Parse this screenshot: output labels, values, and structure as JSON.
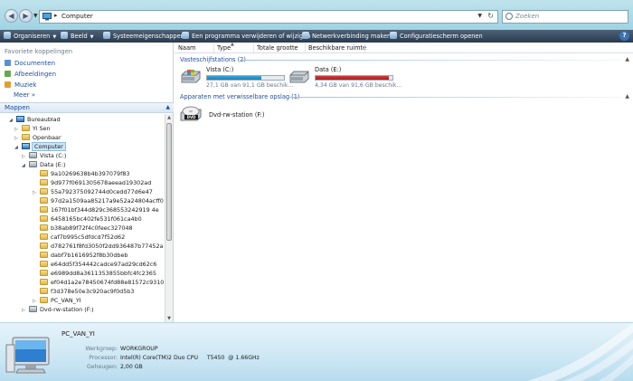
{
  "address": {
    "path": "Computer",
    "search_placeholder": "Zoeken"
  },
  "toolbar": {
    "items": [
      {
        "label": "Organiseren",
        "dropdown": true
      },
      {
        "label": "Beeld",
        "dropdown": true
      },
      {
        "label": "Systeemeigenschappen"
      },
      {
        "label": "Een programma verwijderen of wijzigen"
      },
      {
        "label": "Netwerkverbinding maken"
      },
      {
        "label": "Configuratiescherm openen"
      }
    ],
    "help": "?"
  },
  "left": {
    "favorites_title": "Favoriete koppelingen",
    "favorites": [
      {
        "label": "Documenten",
        "color": "#5b8fd0"
      },
      {
        "label": "Afbeeldingen",
        "color": "#6aa84f"
      },
      {
        "label": "Muziek",
        "color": "#e0a030"
      }
    ],
    "more_label": "Meer",
    "more_glyph": "»",
    "folders_label": "Mappen",
    "tree": [
      {
        "label": "Bureaublad",
        "indent": 0,
        "toggle": "◢",
        "icon": "desktop"
      },
      {
        "label": "Yi Sen",
        "indent": 1,
        "toggle": "▷",
        "icon": "folder"
      },
      {
        "label": "Openbaar",
        "indent": 1,
        "toggle": "▷",
        "icon": "folder"
      },
      {
        "label": "Computer",
        "indent": 1,
        "toggle": "◢",
        "icon": "computer",
        "selected": true
      },
      {
        "label": "Vista (C:)",
        "indent": 2,
        "toggle": "▷",
        "icon": "drive"
      },
      {
        "label": "Data (E:)",
        "indent": 2,
        "toggle": "◢",
        "icon": "drive"
      },
      {
        "label": "9a10269638b4b397079f83",
        "indent": 3,
        "toggle": "",
        "icon": "folder"
      },
      {
        "label": "9d977f0691305678aeead19302ad",
        "indent": 3,
        "toggle": "",
        "icon": "folder"
      },
      {
        "label": "55a792375092744d0cedd77d6e47",
        "indent": 3,
        "toggle": "▷",
        "icon": "folder"
      },
      {
        "label": "97d2a1509aa85217a9e52a24804acff0",
        "indent": 3,
        "toggle": "",
        "icon": "folder"
      },
      {
        "label": "167f01bf344d829c368553242919 4e",
        "indent": 3,
        "toggle": "",
        "icon": "folder"
      },
      {
        "label": "6458165bc402fe531f061ca4b0",
        "indent": 3,
        "toggle": "",
        "icon": "folder"
      },
      {
        "label": "b38ab89f72f4c0feec327048",
        "indent": 3,
        "toggle": "",
        "icon": "folder"
      },
      {
        "label": "caf7b995c5dfdcd7f52d62",
        "indent": 3,
        "toggle": "",
        "icon": "folder"
      },
      {
        "label": "d782761f8fd3050f2dd936487b77452a",
        "indent": 3,
        "toggle": "",
        "icon": "folder"
      },
      {
        "label": "dabf7b1616952f8b30dbeb",
        "indent": 3,
        "toggle": "",
        "icon": "folder"
      },
      {
        "label": "e64dd5f354442cadce97ad29cd62c6",
        "indent": 3,
        "toggle": "",
        "icon": "folder"
      },
      {
        "label": "e6989dd8a3611353855bbfc4fc2365",
        "indent": 3,
        "toggle": "",
        "icon": "folder"
      },
      {
        "label": "ef04d1a2e78450674fd88e81572c9310",
        "indent": 3,
        "toggle": "",
        "icon": "folder"
      },
      {
        "label": "f3d378e50e3c920ac9f0d5b3",
        "indent": 3,
        "toggle": "",
        "icon": "folder"
      },
      {
        "label": "PC_VAN_YI",
        "indent": 3,
        "toggle": "▷",
        "icon": "folder"
      },
      {
        "label": "Dvd-rw-station (F:)",
        "indent": 2,
        "toggle": "▷",
        "icon": "dvd"
      }
    ]
  },
  "columns": [
    "Naam",
    "Type",
    "Totale grootte",
    "Beschikbare ruimte"
  ],
  "groups": {
    "hard_disks": {
      "title": "Vasteschijfstations (2)",
      "drives": [
        {
          "name": "Vista (C:)",
          "free_text": "27,1 GB van 91,1 GB beschik...",
          "used_fraction": 0.7,
          "bar_color": "#37a7d8"
        },
        {
          "name": "Data (E:)",
          "free_text": "4,34 GB van 91,6 GB beschik...",
          "used_fraction": 0.95,
          "bar_color": "#d23a3a"
        }
      ]
    },
    "removable": {
      "title": "Apparaten met verwisselbare opslag (1)",
      "devices": [
        {
          "name": "Dvd-rw-station (F:)",
          "badge": "DVD"
        }
      ]
    }
  },
  "details": {
    "title": "PC_VAN_YI",
    "rows": [
      {
        "label": "Werkgroep:",
        "value": "WORKGROUP"
      },
      {
        "label": "Processor:",
        "value": "Intel(R) Core(TM)2 Duo CPU     T5450  @ 1.66GHz"
      },
      {
        "label": "Geheugen:",
        "value": "2,00 GB"
      }
    ]
  }
}
